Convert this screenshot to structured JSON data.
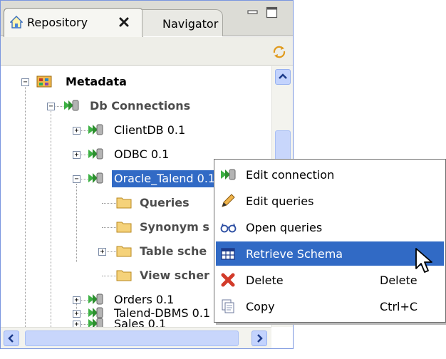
{
  "tabs": {
    "repository": "Repository",
    "navigator": "Navigator"
  },
  "tree": {
    "metadata": "Metadata",
    "db_connections": "Db Connections",
    "items": [
      "ClientDB 0.1",
      "ODBC 0.1",
      "Oracle_Talend 0.1"
    ],
    "oracle_children": [
      "Queries",
      "Synonym s",
      "Table sche",
      "View scher"
    ],
    "more_items": [
      "Orders 0.1",
      "Sales 0.1",
      "Talend-DBMS 0.1"
    ]
  },
  "context_menu": {
    "edit_connection": "Edit connection",
    "edit_queries": "Edit queries",
    "open_queries": "Open queries",
    "retrieve_schema": "Retrieve Schema",
    "delete": "Delete",
    "delete_shortcut": "Delete",
    "copy": "Copy",
    "copy_shortcut": "Ctrl+C"
  },
  "colors": {
    "selection": "#316ac5",
    "tab_border": "#8b8b84"
  },
  "icons": [
    "home-icon",
    "close-icon",
    "minimize-icon",
    "maximize-icon",
    "sync-icon",
    "metadata-icon",
    "db-connection-icon",
    "folder-icon",
    "edit-connection-icon",
    "pencil-icon",
    "glasses-icon",
    "table-icon",
    "delete-x-icon",
    "copy-icon",
    "mouse-cursor-icon"
  ]
}
